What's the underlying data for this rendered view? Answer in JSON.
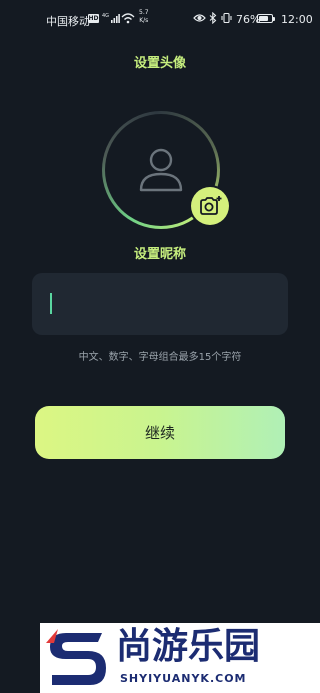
{
  "status_bar": {
    "carrier": "中国移动",
    "hd_badge": "HD",
    "net_speed_value": "5.7",
    "net_speed_unit": "K/s",
    "battery_pct": "76%",
    "battery_level": 0.76,
    "time": "12:00",
    "icons": [
      "signal-4g-icon",
      "wifi-icon",
      "eye-icon",
      "bluetooth-icon",
      "vibrate-icon",
      "battery-icon"
    ]
  },
  "avatar_section": {
    "title": "设置头像",
    "placeholder_icon": "user-silhouette-icon",
    "camera_icon": "camera-icon"
  },
  "nickname_section": {
    "title": "设置昵称",
    "input_value": "",
    "hint": "中文、数字、字母组合最多15个字符"
  },
  "actions": {
    "continue_label": "继续"
  },
  "watermark": {
    "logo_text": "尚游乐园",
    "url": "SHYIYUANYK.COM"
  },
  "colors": {
    "background": "#141a22",
    "accent": "#c6ee7e",
    "input_bg": "#202832",
    "cursor": "#5ad6a0"
  }
}
